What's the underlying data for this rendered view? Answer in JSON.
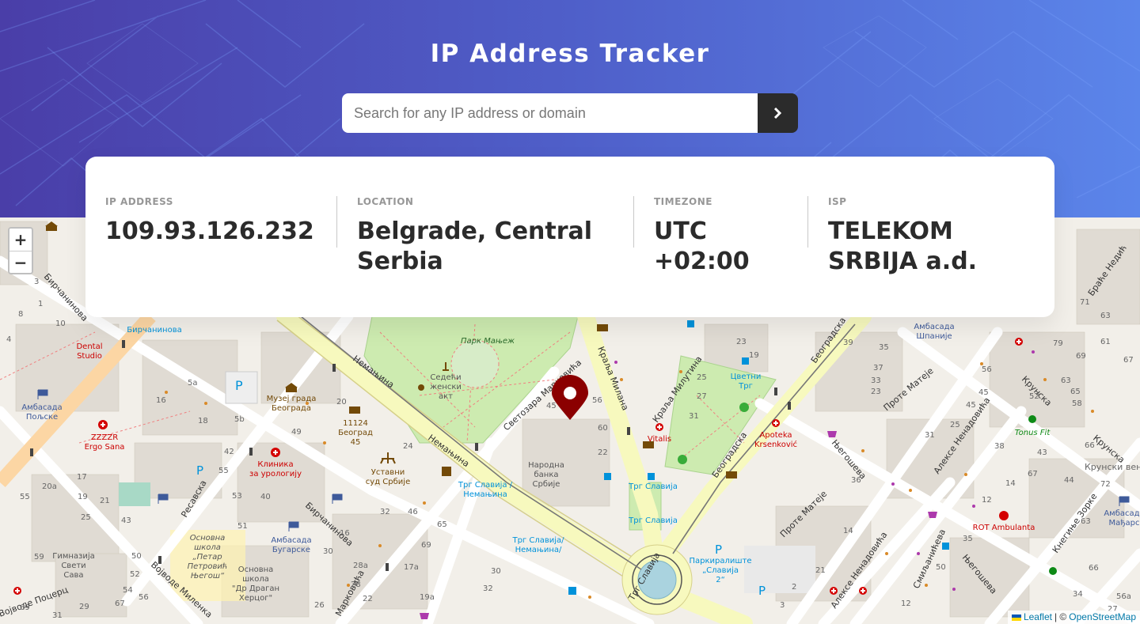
{
  "app": {
    "title": "IP Address Tracker"
  },
  "search": {
    "placeholder": "Search for any IP address or domain",
    "value": "",
    "submit_icon": "chevron-right-icon"
  },
  "info": {
    "ip": {
      "label": "IP ADDRESS",
      "value": "109.93.126.232"
    },
    "location": {
      "label": "LOCATION",
      "value": "Belgrade, Central Serbia"
    },
    "timezone": {
      "label": "TIMEZONE",
      "value": "UTC +02:00"
    },
    "isp": {
      "label": "ISP",
      "value": "TELEKOM SRBIJA a.d."
    }
  },
  "map": {
    "zoom_in": "+",
    "zoom_out": "−",
    "marker_icon": "location-pin-icon",
    "attribution": {
      "leaflet": "Leaflet",
      "separator": "| ©",
      "osm": "OpenStreetMap"
    },
    "labels": {
      "park": "Парк Мањеж",
      "nemanjina1": "Немањина",
      "nemanjina2": "Немањина",
      "kralja_milana": "Краља Милана",
      "svetozara": "Светозара Марковића",
      "kralja_milutina": "Краља Милутина",
      "beogradska1": "Београдска",
      "beogradska2": "Београдска",
      "prote_mateje1": "Проте Матеје",
      "prote_mateje2": "Проте Матеје",
      "njegoseva1": "Његошева",
      "njegoseva2": "Његошева",
      "aleksa1": "Алексе Ненадовића",
      "aleksa2": "Алексе Ненадовића",
      "krunska1": "Крунска",
      "krunska2": "Крунска",
      "krunski": "Крунски вен",
      "kneginje": "Кнегиње Зорке",
      "brace": "Браће Недић",
      "resavska": "Ресавска",
      "birc1": "Бирчанинова",
      "birc2": "Бирчанинова",
      "birc3": "Бирчанинова",
      "vojvode": "Војводе Миленка",
      "markoviceva": "Марковића",
      "smiljaniceva": "Смиљанићева",
      "trg_slavija": "Трг Славија",
      "slavija_stop1": "Трг Славија /",
      "slavija_stop1b": "Немањина",
      "slavija_stop2": "Трг Славија/",
      "slavija_stop2b": "Немањина/",
      "slavija_a": "Трг Славија",
      "slavija_b": "Трг Славија",
      "cvetni": "Цветни",
      "cvetni2": "Трг",
      "vitalis": "Vitalis",
      "apoteka": "Apoteka",
      "apoteka2": "Krsenković",
      "narodna": "Народна",
      "narodna2": "банка",
      "narodna3": "Србије",
      "muzej": "Музеј града",
      "muzej2": "Београда",
      "beograd45a": "11124",
      "beograd45b": "Београд",
      "beograd45c": "45",
      "sud": "Уставни",
      "sud2": "суд Србије",
      "sedeci": "Седећи",
      "sedeci2": "женски",
      "sedeci3": "акт",
      "klinika": "Клиника",
      "klinika2": "за урологију",
      "ambasada_poljske": "Амбасада",
      "ambasada_poljske2": "Пољске",
      "ambasada_bugarske": "Амбасада",
      "ambasada_bugarske2": "Бугарске",
      "ambasada_spanije": "Амбасада",
      "ambasada_spanije2": "Шпаније",
      "ambasada_madj": "Амбасада",
      "ambasada_madj2": "Мађарс",
      "dental": "Dental",
      "dental2": "Studio",
      "zzzzr": "ZZZZR",
      "zzzzr2": "Ergo Sana",
      "gimnazija": "Гимназија",
      "gimnazija2": "Свети",
      "gimnazija3": "Сава",
      "skola1": "Основна",
      "skola1b": "школа",
      "skola1c": "„Петар",
      "skola1d": "Петровић",
      "skola1e": "Његош“",
      "skola2": "Основна",
      "skola2b": "школа",
      "skola2c": "\"Др Драган",
      "skola2d": "Херцог\"",
      "parking": "Паркиралиште",
      "parking2": "„Славија",
      "parking3": "2“",
      "tonus": "Tonus Fit",
      "rot": "ROT Ambulanta",
      "bircaninova_stop": "Бирчанинова",
      "poc": "Војводе Поцерц"
    }
  }
}
